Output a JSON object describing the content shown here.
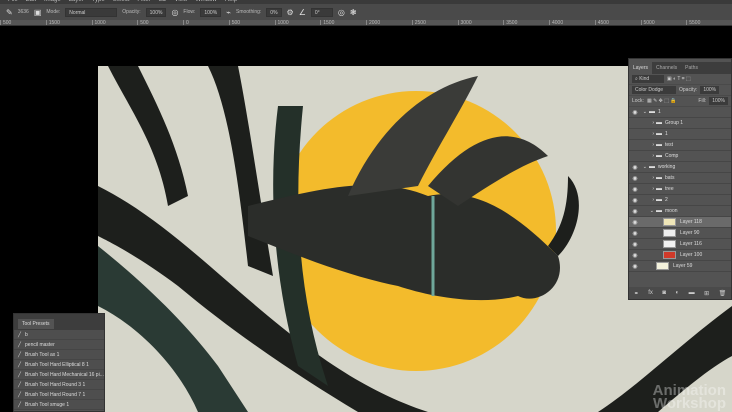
{
  "menu": [
    "File",
    "Edit",
    "Image",
    "Layer",
    "Type",
    "Select",
    "Filter",
    "3D",
    "View",
    "Window",
    "Help"
  ],
  "options": {
    "brush_size": "3636",
    "mode_label": "Mode:",
    "mode": "Normal",
    "opacity_label": "Opacity:",
    "opacity": "100%",
    "flow_label": "Flow:",
    "flow": "100%",
    "smoothing_label": "Smoothing:",
    "smoothing": "0%",
    "angle": "0°"
  },
  "ruler": [
    "500",
    "1500",
    "1000",
    "500",
    "0",
    "500",
    "1000",
    "1500",
    "2000",
    "2500",
    "3000",
    "3500",
    "4000",
    "4500",
    "5000",
    "5500"
  ],
  "layers_panel": {
    "tabs": [
      "Layers",
      "Channels",
      "Paths"
    ],
    "filter": "Kind",
    "blend_mode": "Color Dodge",
    "opacity_label": "Opacity:",
    "opacity": "100%",
    "lock_label": "Lock:",
    "fill_label": "Fill:",
    "fill": "100%",
    "layers": [
      {
        "name": "1",
        "type": "group",
        "visible": true,
        "indent": 0,
        "open": true
      },
      {
        "name": "Group 1",
        "type": "group",
        "visible": false,
        "indent": 1
      },
      {
        "name": "1",
        "type": "group",
        "visible": false,
        "indent": 1
      },
      {
        "name": "test",
        "type": "group",
        "visible": false,
        "indent": 1
      },
      {
        "name": "Comp",
        "type": "group",
        "visible": false,
        "indent": 1
      },
      {
        "name": "working",
        "type": "group",
        "visible": true,
        "indent": 0,
        "open": true
      },
      {
        "name": "bats",
        "type": "group",
        "visible": true,
        "indent": 1
      },
      {
        "name": "tree",
        "type": "group",
        "visible": true,
        "indent": 1
      },
      {
        "name": "2",
        "type": "group",
        "visible": true,
        "indent": 1
      },
      {
        "name": "moon",
        "type": "group",
        "visible": true,
        "indent": 1,
        "open": true
      },
      {
        "name": "Layer 118",
        "type": "layer",
        "visible": true,
        "indent": 2,
        "thumb": "#efe6b8",
        "active": true
      },
      {
        "name": "Layer 90",
        "type": "layer",
        "visible": true,
        "indent": 2,
        "thumb": "#eeeeee"
      },
      {
        "name": "Layer 116",
        "type": "layer",
        "visible": true,
        "indent": 2,
        "thumb": "#f2f2f2"
      },
      {
        "name": "Layer 100",
        "type": "layer",
        "visible": true,
        "indent": 2,
        "thumb": "#d03a2a"
      },
      {
        "name": "Layer 59",
        "type": "layer",
        "visible": true,
        "indent": 1,
        "thumb": "#f3f1dc"
      }
    ]
  },
  "tool_presets": {
    "title": "Tool Presets",
    "items": [
      "b",
      "pencil master",
      "Brush Tool ax 1",
      "Brush Tool Hard Elliptical 8 1",
      "Brush Tool Hard Mechanical 16 pi...",
      "Brush Tool Hard Round 3 1",
      "Brush Tool Hard Round 7 1",
      "Brush Tool smuge 1"
    ]
  },
  "watermark": [
    "Animation",
    "Workshop"
  ],
  "colors": {
    "moon": "#f3bb2c",
    "background": "#d6d6ca",
    "branch": "#1d1f1c",
    "teal": "#5d7f72"
  }
}
